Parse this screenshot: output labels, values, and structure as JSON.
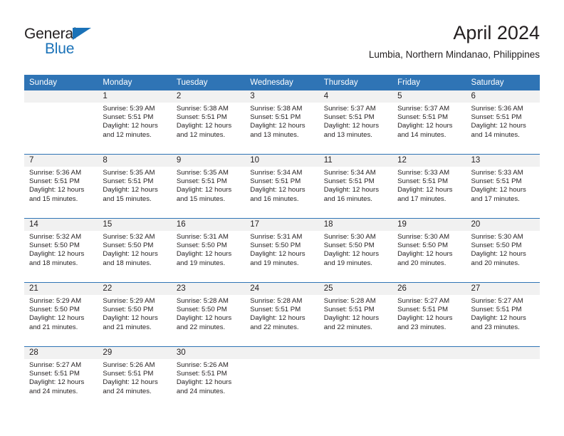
{
  "brand": {
    "name_part1": "General",
    "name_part2": "Blue",
    "accent_color": "#1a72b8"
  },
  "header": {
    "title": "April 2024",
    "location": "Lumbia, Northern Mindanao, Philippines"
  },
  "theme": {
    "header_blue": "#2f74b5",
    "daynum_band": "#f1f1f1",
    "text": "#231f20"
  },
  "calendar": {
    "weekday_headers": [
      "Sunday",
      "Monday",
      "Tuesday",
      "Wednesday",
      "Thursday",
      "Friday",
      "Saturday"
    ],
    "weeks": [
      [
        {
          "day": "",
          "sunrise": "",
          "sunset": "",
          "daylight_line1": "",
          "daylight_line2": ""
        },
        {
          "day": "1",
          "sunrise": "Sunrise: 5:39 AM",
          "sunset": "Sunset: 5:51 PM",
          "daylight_line1": "Daylight: 12 hours",
          "daylight_line2": "and 12 minutes."
        },
        {
          "day": "2",
          "sunrise": "Sunrise: 5:38 AM",
          "sunset": "Sunset: 5:51 PM",
          "daylight_line1": "Daylight: 12 hours",
          "daylight_line2": "and 12 minutes."
        },
        {
          "day": "3",
          "sunrise": "Sunrise: 5:38 AM",
          "sunset": "Sunset: 5:51 PM",
          "daylight_line1": "Daylight: 12 hours",
          "daylight_line2": "and 13 minutes."
        },
        {
          "day": "4",
          "sunrise": "Sunrise: 5:37 AM",
          "sunset": "Sunset: 5:51 PM",
          "daylight_line1": "Daylight: 12 hours",
          "daylight_line2": "and 13 minutes."
        },
        {
          "day": "5",
          "sunrise": "Sunrise: 5:37 AM",
          "sunset": "Sunset: 5:51 PM",
          "daylight_line1": "Daylight: 12 hours",
          "daylight_line2": "and 14 minutes."
        },
        {
          "day": "6",
          "sunrise": "Sunrise: 5:36 AM",
          "sunset": "Sunset: 5:51 PM",
          "daylight_line1": "Daylight: 12 hours",
          "daylight_line2": "and 14 minutes."
        }
      ],
      [
        {
          "day": "7",
          "sunrise": "Sunrise: 5:36 AM",
          "sunset": "Sunset: 5:51 PM",
          "daylight_line1": "Daylight: 12 hours",
          "daylight_line2": "and 15 minutes."
        },
        {
          "day": "8",
          "sunrise": "Sunrise: 5:35 AM",
          "sunset": "Sunset: 5:51 PM",
          "daylight_line1": "Daylight: 12 hours",
          "daylight_line2": "and 15 minutes."
        },
        {
          "day": "9",
          "sunrise": "Sunrise: 5:35 AM",
          "sunset": "Sunset: 5:51 PM",
          "daylight_line1": "Daylight: 12 hours",
          "daylight_line2": "and 15 minutes."
        },
        {
          "day": "10",
          "sunrise": "Sunrise: 5:34 AM",
          "sunset": "Sunset: 5:51 PM",
          "daylight_line1": "Daylight: 12 hours",
          "daylight_line2": "and 16 minutes."
        },
        {
          "day": "11",
          "sunrise": "Sunrise: 5:34 AM",
          "sunset": "Sunset: 5:51 PM",
          "daylight_line1": "Daylight: 12 hours",
          "daylight_line2": "and 16 minutes."
        },
        {
          "day": "12",
          "sunrise": "Sunrise: 5:33 AM",
          "sunset": "Sunset: 5:51 PM",
          "daylight_line1": "Daylight: 12 hours",
          "daylight_line2": "and 17 minutes."
        },
        {
          "day": "13",
          "sunrise": "Sunrise: 5:33 AM",
          "sunset": "Sunset: 5:51 PM",
          "daylight_line1": "Daylight: 12 hours",
          "daylight_line2": "and 17 minutes."
        }
      ],
      [
        {
          "day": "14",
          "sunrise": "Sunrise: 5:32 AM",
          "sunset": "Sunset: 5:50 PM",
          "daylight_line1": "Daylight: 12 hours",
          "daylight_line2": "and 18 minutes."
        },
        {
          "day": "15",
          "sunrise": "Sunrise: 5:32 AM",
          "sunset": "Sunset: 5:50 PM",
          "daylight_line1": "Daylight: 12 hours",
          "daylight_line2": "and 18 minutes."
        },
        {
          "day": "16",
          "sunrise": "Sunrise: 5:31 AM",
          "sunset": "Sunset: 5:50 PM",
          "daylight_line1": "Daylight: 12 hours",
          "daylight_line2": "and 19 minutes."
        },
        {
          "day": "17",
          "sunrise": "Sunrise: 5:31 AM",
          "sunset": "Sunset: 5:50 PM",
          "daylight_line1": "Daylight: 12 hours",
          "daylight_line2": "and 19 minutes."
        },
        {
          "day": "18",
          "sunrise": "Sunrise: 5:30 AM",
          "sunset": "Sunset: 5:50 PM",
          "daylight_line1": "Daylight: 12 hours",
          "daylight_line2": "and 19 minutes."
        },
        {
          "day": "19",
          "sunrise": "Sunrise: 5:30 AM",
          "sunset": "Sunset: 5:50 PM",
          "daylight_line1": "Daylight: 12 hours",
          "daylight_line2": "and 20 minutes."
        },
        {
          "day": "20",
          "sunrise": "Sunrise: 5:30 AM",
          "sunset": "Sunset: 5:50 PM",
          "daylight_line1": "Daylight: 12 hours",
          "daylight_line2": "and 20 minutes."
        }
      ],
      [
        {
          "day": "21",
          "sunrise": "Sunrise: 5:29 AM",
          "sunset": "Sunset: 5:50 PM",
          "daylight_line1": "Daylight: 12 hours",
          "daylight_line2": "and 21 minutes."
        },
        {
          "day": "22",
          "sunrise": "Sunrise: 5:29 AM",
          "sunset": "Sunset: 5:50 PM",
          "daylight_line1": "Daylight: 12 hours",
          "daylight_line2": "and 21 minutes."
        },
        {
          "day": "23",
          "sunrise": "Sunrise: 5:28 AM",
          "sunset": "Sunset: 5:50 PM",
          "daylight_line1": "Daylight: 12 hours",
          "daylight_line2": "and 22 minutes."
        },
        {
          "day": "24",
          "sunrise": "Sunrise: 5:28 AM",
          "sunset": "Sunset: 5:51 PM",
          "daylight_line1": "Daylight: 12 hours",
          "daylight_line2": "and 22 minutes."
        },
        {
          "day": "25",
          "sunrise": "Sunrise: 5:28 AM",
          "sunset": "Sunset: 5:51 PM",
          "daylight_line1": "Daylight: 12 hours",
          "daylight_line2": "and 22 minutes."
        },
        {
          "day": "26",
          "sunrise": "Sunrise: 5:27 AM",
          "sunset": "Sunset: 5:51 PM",
          "daylight_line1": "Daylight: 12 hours",
          "daylight_line2": "and 23 minutes."
        },
        {
          "day": "27",
          "sunrise": "Sunrise: 5:27 AM",
          "sunset": "Sunset: 5:51 PM",
          "daylight_line1": "Daylight: 12 hours",
          "daylight_line2": "and 23 minutes."
        }
      ],
      [
        {
          "day": "28",
          "sunrise": "Sunrise: 5:27 AM",
          "sunset": "Sunset: 5:51 PM",
          "daylight_line1": "Daylight: 12 hours",
          "daylight_line2": "and 24 minutes."
        },
        {
          "day": "29",
          "sunrise": "Sunrise: 5:26 AM",
          "sunset": "Sunset: 5:51 PM",
          "daylight_line1": "Daylight: 12 hours",
          "daylight_line2": "and 24 minutes."
        },
        {
          "day": "30",
          "sunrise": "Sunrise: 5:26 AM",
          "sunset": "Sunset: 5:51 PM",
          "daylight_line1": "Daylight: 12 hours",
          "daylight_line2": "and 24 minutes."
        },
        {
          "day": "",
          "sunrise": "",
          "sunset": "",
          "daylight_line1": "",
          "daylight_line2": ""
        },
        {
          "day": "",
          "sunrise": "",
          "sunset": "",
          "daylight_line1": "",
          "daylight_line2": ""
        },
        {
          "day": "",
          "sunrise": "",
          "sunset": "",
          "daylight_line1": "",
          "daylight_line2": ""
        },
        {
          "day": "",
          "sunrise": "",
          "sunset": "",
          "daylight_line1": "",
          "daylight_line2": ""
        }
      ]
    ]
  }
}
